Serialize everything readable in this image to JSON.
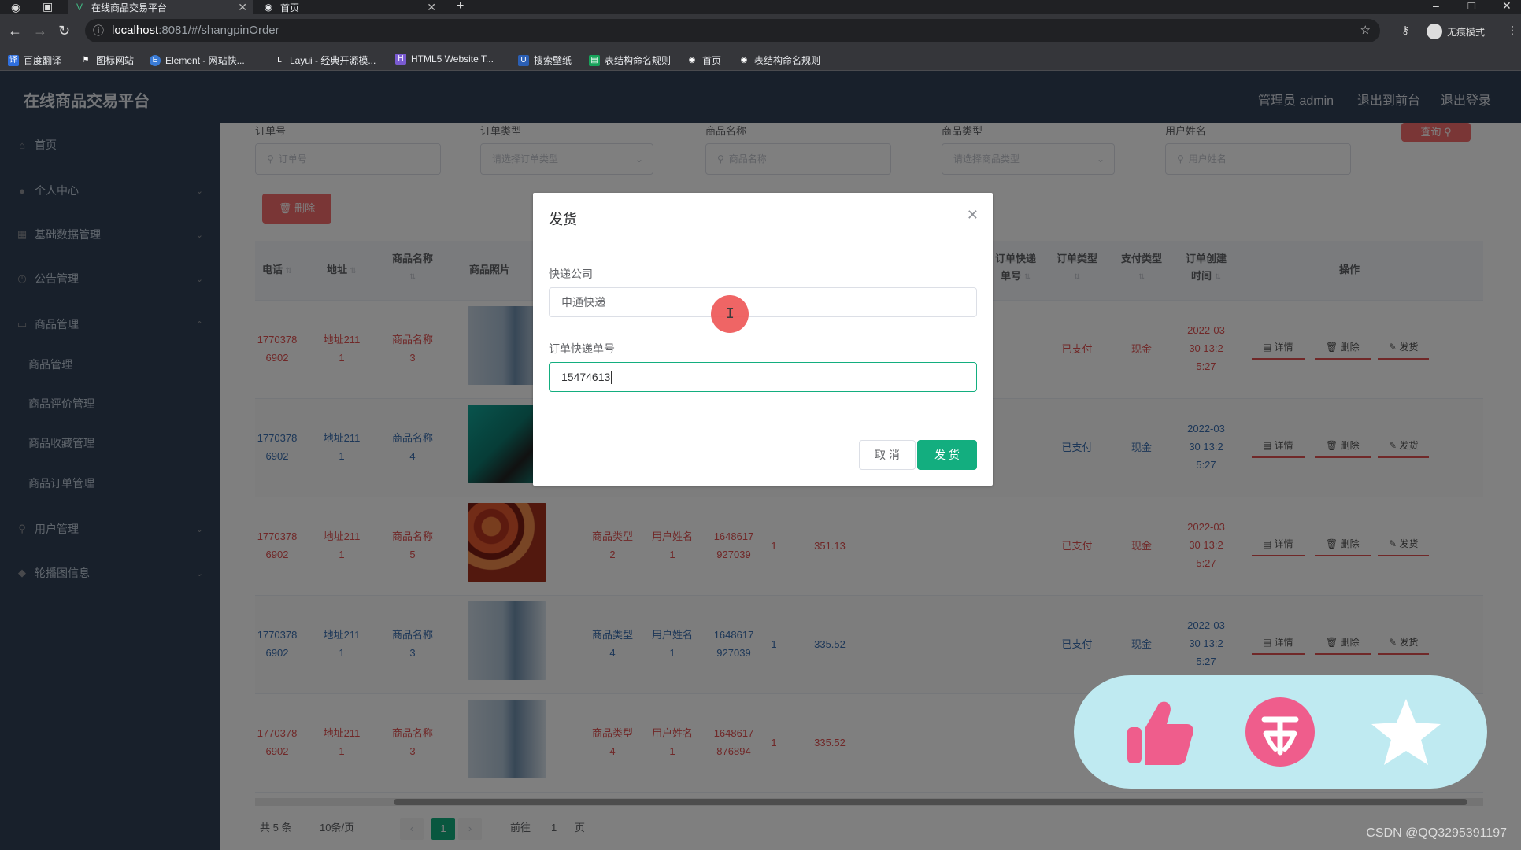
{
  "browser": {
    "tabs": [
      {
        "label": "在线商品交易平台",
        "active": true
      },
      {
        "label": "首页",
        "active": false
      }
    ],
    "url_host": "localhost",
    "url_path": ":8081/#/shangpinOrder",
    "profile_label": "无痕模式",
    "bookmarks": [
      "百度翻译",
      "图标网站",
      "Element - 网站快...",
      "Layui - 经典开源模...",
      "HTML5 Website T...",
      "搜索壁纸",
      "表结构命名规则",
      "首页",
      "表结构命名规则"
    ]
  },
  "app": {
    "title": "在线商品交易平台",
    "header_links": [
      "管理员 admin",
      "退出到前台",
      "退出登录"
    ]
  },
  "sidebar": {
    "items": [
      {
        "label": "首页",
        "icon": "home-icon"
      },
      {
        "label": "个人中心",
        "icon": "user-icon"
      },
      {
        "label": "基础数据管理",
        "icon": "data-icon"
      },
      {
        "label": "公告管理",
        "icon": "notice-icon"
      },
      {
        "label": "商品管理",
        "icon": "goods-icon"
      },
      {
        "label": "用户管理",
        "icon": "users-icon"
      },
      {
        "label": "轮播图信息",
        "icon": "carousel-icon"
      }
    ],
    "sub_items": [
      "商品管理",
      "商品评价管理",
      "商品收藏管理",
      "商品订单管理"
    ]
  },
  "search": {
    "fields": [
      {
        "label": "订单号",
        "placeholder": "订单号"
      },
      {
        "label": "订单类型",
        "placeholder": "请选择订单类型"
      },
      {
        "label": "商品名称",
        "placeholder": "商品名称"
      },
      {
        "label": "商品类型",
        "placeholder": "请选择商品类型"
      },
      {
        "label": "用户姓名",
        "placeholder": "用户姓名"
      }
    ],
    "query_label": "查询",
    "delete_label": "删除"
  },
  "table": {
    "headers": {
      "phone": "电话",
      "address": "地址",
      "goods_name": "商品名称",
      "goods_photo": "商品照片",
      "express_no_1": "订单快递",
      "express_no_2": "单号",
      "order_type": "订单类型",
      "pay_type": "支付类型",
      "create_time_1": "订单创建",
      "create_time_2": "时间",
      "actions": "操作"
    },
    "rows": [
      {
        "phone1": "1770378",
        "phone2": "6902",
        "addr1": "地址211",
        "addr2": "1",
        "name1": "商品名称",
        "name2": "3",
        "type1": "",
        "type2": "",
        "user1": "",
        "user2": "",
        "no1": "",
        "no2": "",
        "qty": "",
        "price": "",
        "order_type": "已支付",
        "pay": "现金",
        "t1": "2022-03",
        "t2": "30 13:2",
        "t3": "5:27",
        "color": "red"
      },
      {
        "phone1": "1770378",
        "phone2": "6902",
        "addr1": "地址211",
        "addr2": "1",
        "name1": "商品名称",
        "name2": "4",
        "type1": "",
        "type2": "",
        "user1": "",
        "user2": "",
        "no1": "",
        "no2": "",
        "qty": "",
        "price": "",
        "order_type": "已支付",
        "pay": "现金",
        "t1": "2022-03",
        "t2": "30 13:2",
        "t3": "5:27",
        "color": "blue"
      },
      {
        "phone1": "1770378",
        "phone2": "6902",
        "addr1": "地址211",
        "addr2": "1",
        "name1": "商品名称",
        "name2": "5",
        "type1": "商品类型",
        "type2": "2",
        "user1": "用户姓名",
        "user2": "1",
        "no1": "1648617",
        "no2": "927039",
        "qty": "1",
        "price": "351.13",
        "order_type": "已支付",
        "pay": "现金",
        "t1": "2022-03",
        "t2": "30 13:2",
        "t3": "5:27",
        "color": "red"
      },
      {
        "phone1": "1770378",
        "phone2": "6902",
        "addr1": "地址211",
        "addr2": "1",
        "name1": "商品名称",
        "name2": "3",
        "type1": "商品类型",
        "type2": "4",
        "user1": "用户姓名",
        "user2": "1",
        "no1": "1648617",
        "no2": "927039",
        "qty": "1",
        "price": "335.52",
        "order_type": "已支付",
        "pay": "现金",
        "t1": "2022-03",
        "t2": "30 13:2",
        "t3": "5:27",
        "color": "blue"
      },
      {
        "phone1": "1770378",
        "phone2": "6902",
        "addr1": "地址211",
        "addr2": "1",
        "name1": "商品名称",
        "name2": "3",
        "type1": "商品类型",
        "type2": "4",
        "user1": "用户姓名",
        "user2": "1",
        "no1": "1648617",
        "no2": "876894",
        "qty": "1",
        "price": "335.52",
        "order_type": "",
        "pay": "",
        "t1": "",
        "t2": "",
        "t3": "",
        "color": "red"
      }
    ],
    "ops": {
      "detail": "详情",
      "delete": "删除",
      "ship": "发货"
    }
  },
  "pagination": {
    "total": "共 5 条",
    "page_size": "10条/页",
    "current": "1",
    "goto_label": "前往",
    "goto_value": "1",
    "page_unit": "页"
  },
  "dialog": {
    "title": "发货",
    "express_company_label": "快递公司",
    "express_company_value": "申通快递",
    "express_no_label": "订单快递单号",
    "express_no_value": "15474613",
    "cancel_label": "取 消",
    "confirm_label": "发 货"
  },
  "watermark": "CSDN @QQ3295391197",
  "colors": {
    "sidebar_bg": "#304156",
    "primary": "#13ae7f",
    "danger": "#f56c6c",
    "float_panel": "#bfeaf1",
    "float_icon": "#ef5d8c"
  }
}
